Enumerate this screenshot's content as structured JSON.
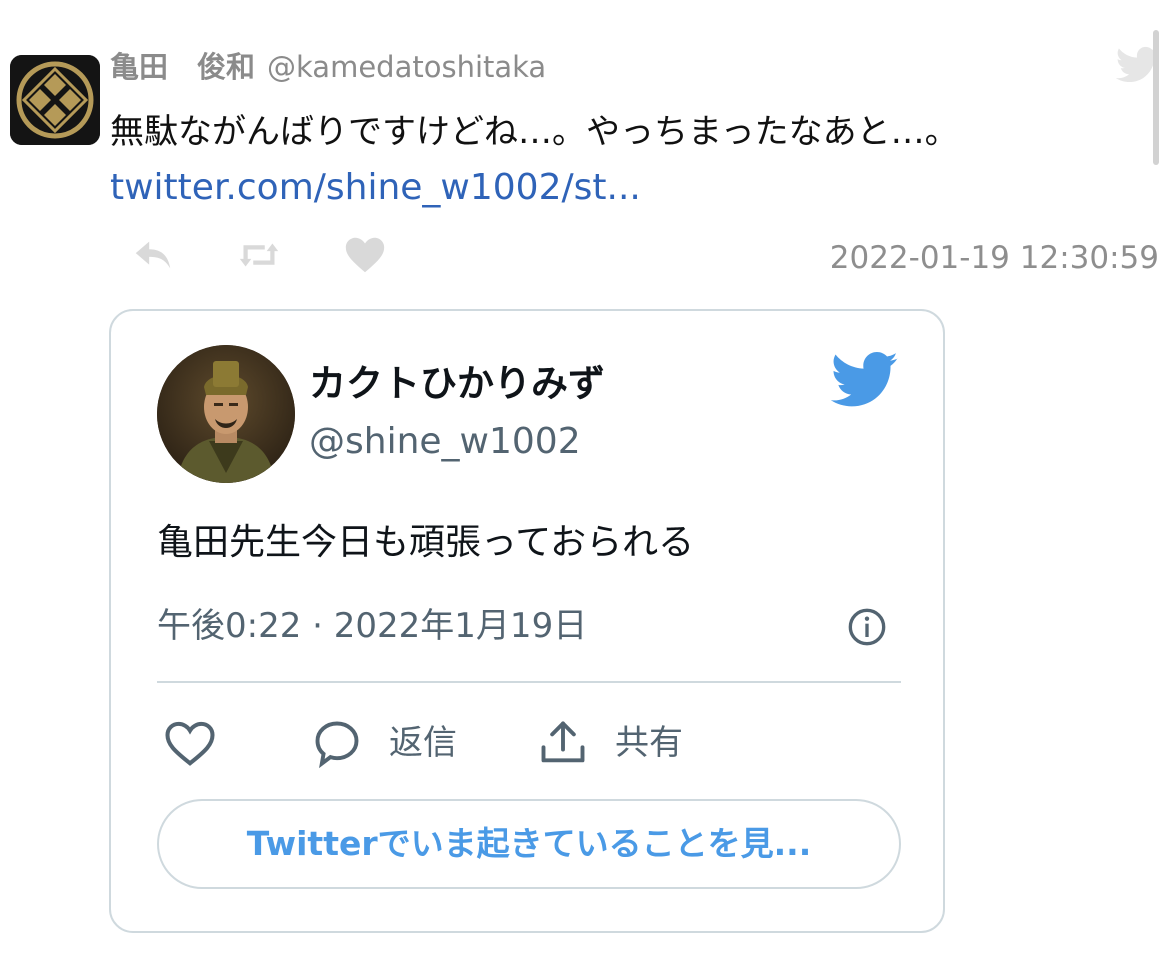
{
  "tweet": {
    "display_name": "亀田　俊和",
    "handle": "@kamedatoshitaka",
    "text": "無駄ながんばりですけどね…。やっちまったなあと…。",
    "link": "twitter.com/shine_w1002/st...",
    "timestamp": "2022-01-19 12:30:59",
    "avatar_icon": "family-crest-avatar",
    "actions": [
      "reply-icon",
      "retweet-icon",
      "like-icon"
    ]
  },
  "embed": {
    "display_name": "カクトひかりみず",
    "handle": "@shine_w1002",
    "text": "亀田先生今日も頑張っておられる",
    "time": "午後0:22 · 2022年1月19日",
    "reply_label": "返信",
    "share_label": "共有",
    "cta_label": "Twitterでいま起きていることを見...",
    "avatar_icon": "warrior-portrait-avatar"
  },
  "colors": {
    "link": "#2f63b8",
    "twitter_blue": "#4a9ae6",
    "muted": "#536471",
    "border": "#cfd9de",
    "meta_gray": "#8e8e8e"
  }
}
